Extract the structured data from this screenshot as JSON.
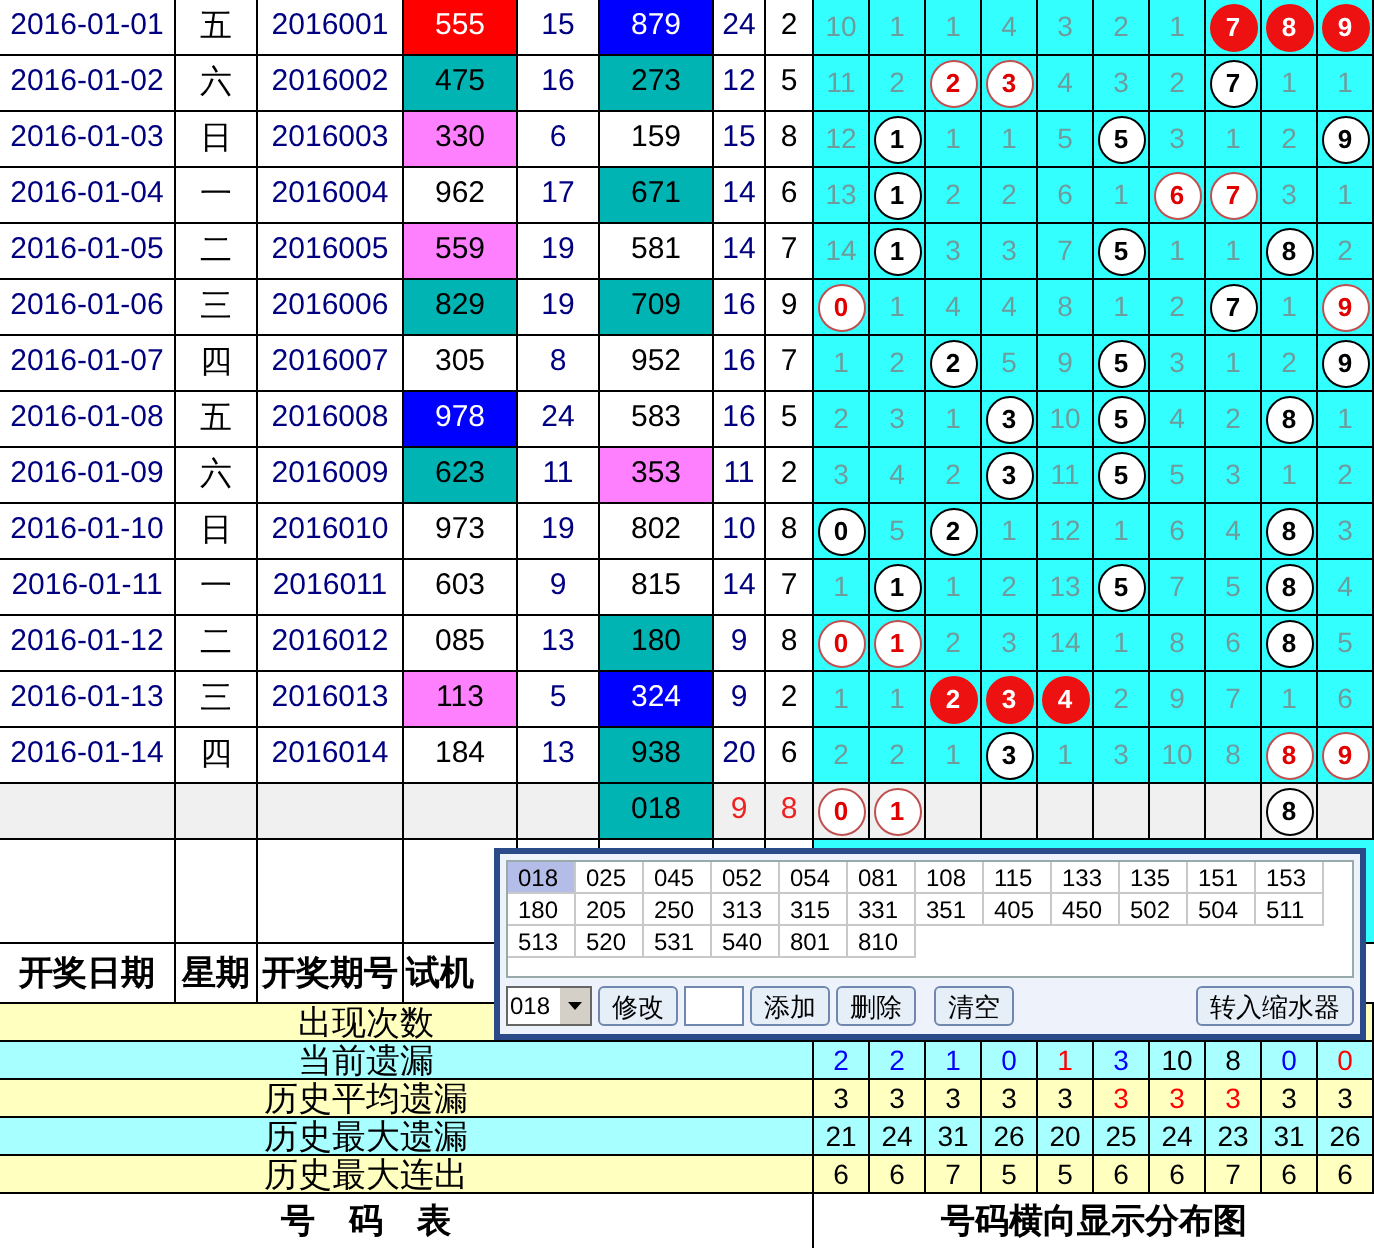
{
  "rows": [
    {
      "date": "2016-01-01",
      "week": "五",
      "issue": "2016001",
      "test": {
        "value": "555",
        "color": "#ff0000"
      },
      "test_sum": "15",
      "open": {
        "value": "879",
        "color": "#0000ff"
      },
      "open_sum": "24",
      "span": "2",
      "cells": [
        {
          "value": "10",
          "kind": "miss"
        },
        {
          "value": "1",
          "kind": "miss"
        },
        {
          "value": "1",
          "kind": "miss"
        },
        {
          "value": "4",
          "kind": "miss"
        },
        {
          "value": "3",
          "kind": "miss"
        },
        {
          "value": "2",
          "kind": "miss"
        },
        {
          "value": "1",
          "kind": "miss"
        },
        {
          "value": "7",
          "kind": "hot"
        },
        {
          "value": "8",
          "kind": "hot"
        },
        {
          "value": "9",
          "kind": "hot"
        }
      ]
    },
    {
      "date": "2016-01-02",
      "week": "六",
      "issue": "2016002",
      "test": {
        "value": "475",
        "color": "#00b4b4"
      },
      "test_sum": "16",
      "open": {
        "value": "273",
        "color": "#00b4b4"
      },
      "open_sum": "12",
      "span": "5",
      "cells": [
        {
          "value": "11",
          "kind": "miss"
        },
        {
          "value": "2",
          "kind": "miss"
        },
        {
          "value": "2",
          "kind": "red"
        },
        {
          "value": "3",
          "kind": "red"
        },
        {
          "value": "4",
          "kind": "miss"
        },
        {
          "value": "3",
          "kind": "miss"
        },
        {
          "value": "2",
          "kind": "miss"
        },
        {
          "value": "7",
          "kind": "hit"
        },
        {
          "value": "1",
          "kind": "miss"
        },
        {
          "value": "1",
          "kind": "miss"
        }
      ]
    },
    {
      "date": "2016-01-03",
      "week": "日",
      "issue": "2016003",
      "test": {
        "value": "330",
        "color": "#ff80ff"
      },
      "test_sum": "6",
      "open": {
        "value": "159"
      },
      "open_sum": "15",
      "span": "8",
      "cells": [
        {
          "value": "12",
          "kind": "miss"
        },
        {
          "value": "1",
          "kind": "hit"
        },
        {
          "value": "1",
          "kind": "miss"
        },
        {
          "value": "1",
          "kind": "miss"
        },
        {
          "value": "5",
          "kind": "miss"
        },
        {
          "value": "5",
          "kind": "hit"
        },
        {
          "value": "3",
          "kind": "miss"
        },
        {
          "value": "1",
          "kind": "miss"
        },
        {
          "value": "2",
          "kind": "miss"
        },
        {
          "value": "9",
          "kind": "hit"
        }
      ]
    },
    {
      "date": "2016-01-04",
      "week": "一",
      "issue": "2016004",
      "test": {
        "value": "962"
      },
      "test_sum": "17",
      "open": {
        "value": "671",
        "color": "#00b4b4"
      },
      "open_sum": "14",
      "span": "6",
      "cells": [
        {
          "value": "13",
          "kind": "miss"
        },
        {
          "value": "1",
          "kind": "hit"
        },
        {
          "value": "2",
          "kind": "miss"
        },
        {
          "value": "2",
          "kind": "miss"
        },
        {
          "value": "6",
          "kind": "miss"
        },
        {
          "value": "1",
          "kind": "miss"
        },
        {
          "value": "6",
          "kind": "red"
        },
        {
          "value": "7",
          "kind": "red"
        },
        {
          "value": "3",
          "kind": "miss"
        },
        {
          "value": "1",
          "kind": "miss"
        }
      ]
    },
    {
      "date": "2016-01-05",
      "week": "二",
      "issue": "2016005",
      "test": {
        "value": "559",
        "color": "#ff80ff"
      },
      "test_sum": "19",
      "open": {
        "value": "581"
      },
      "open_sum": "14",
      "span": "7",
      "cells": [
        {
          "value": "14",
          "kind": "miss"
        },
        {
          "value": "1",
          "kind": "hit"
        },
        {
          "value": "3",
          "kind": "miss"
        },
        {
          "value": "3",
          "kind": "miss"
        },
        {
          "value": "7",
          "kind": "miss"
        },
        {
          "value": "5",
          "kind": "hit"
        },
        {
          "value": "1",
          "kind": "miss"
        },
        {
          "value": "1",
          "kind": "miss"
        },
        {
          "value": "8",
          "kind": "hit"
        },
        {
          "value": "2",
          "kind": "miss"
        }
      ]
    },
    {
      "date": "2016-01-06",
      "week": "三",
      "issue": "2016006",
      "test": {
        "value": "829",
        "color": "#00b4b4"
      },
      "test_sum": "19",
      "open": {
        "value": "709",
        "color": "#00b4b4"
      },
      "open_sum": "16",
      "span": "9",
      "cells": [
        {
          "value": "0",
          "kind": "red"
        },
        {
          "value": "1",
          "kind": "miss"
        },
        {
          "value": "4",
          "kind": "miss"
        },
        {
          "value": "4",
          "kind": "miss"
        },
        {
          "value": "8",
          "kind": "miss"
        },
        {
          "value": "1",
          "kind": "miss"
        },
        {
          "value": "2",
          "kind": "miss"
        },
        {
          "value": "7",
          "kind": "hit"
        },
        {
          "value": "1",
          "kind": "miss"
        },
        {
          "value": "9",
          "kind": "red"
        }
      ]
    },
    {
      "date": "2016-01-07",
      "week": "四",
      "issue": "2016007",
      "test": {
        "value": "305"
      },
      "test_sum": "8",
      "open": {
        "value": "952"
      },
      "open_sum": "16",
      "span": "7",
      "cells": [
        {
          "value": "1",
          "kind": "miss"
        },
        {
          "value": "2",
          "kind": "miss"
        },
        {
          "value": "2",
          "kind": "hit"
        },
        {
          "value": "5",
          "kind": "miss"
        },
        {
          "value": "9",
          "kind": "miss"
        },
        {
          "value": "5",
          "kind": "hit"
        },
        {
          "value": "3",
          "kind": "miss"
        },
        {
          "value": "1",
          "kind": "miss"
        },
        {
          "value": "2",
          "kind": "miss"
        },
        {
          "value": "9",
          "kind": "hit"
        }
      ]
    },
    {
      "date": "2016-01-08",
      "week": "五",
      "issue": "2016008",
      "test": {
        "value": "978",
        "color": "#0000ff"
      },
      "test_sum": "24",
      "open": {
        "value": "583"
      },
      "open_sum": "16",
      "span": "5",
      "cells": [
        {
          "value": "2",
          "kind": "miss"
        },
        {
          "value": "3",
          "kind": "miss"
        },
        {
          "value": "1",
          "kind": "miss"
        },
        {
          "value": "3",
          "kind": "hit"
        },
        {
          "value": "10",
          "kind": "miss"
        },
        {
          "value": "5",
          "kind": "hit"
        },
        {
          "value": "4",
          "kind": "miss"
        },
        {
          "value": "2",
          "kind": "miss"
        },
        {
          "value": "8",
          "kind": "hit"
        },
        {
          "value": "1",
          "kind": "miss"
        }
      ]
    },
    {
      "date": "2016-01-09",
      "week": "六",
      "issue": "2016009",
      "test": {
        "value": "623",
        "color": "#00b4b4"
      },
      "test_sum": "11",
      "open": {
        "value": "353",
        "color": "#ff80ff"
      },
      "open_sum": "11",
      "span": "2",
      "cells": [
        {
          "value": "3",
          "kind": "miss"
        },
        {
          "value": "4",
          "kind": "miss"
        },
        {
          "value": "2",
          "kind": "miss"
        },
        {
          "value": "3",
          "kind": "hit"
        },
        {
          "value": "11",
          "kind": "miss"
        },
        {
          "value": "5",
          "kind": "hit"
        },
        {
          "value": "5",
          "kind": "miss"
        },
        {
          "value": "3",
          "kind": "miss"
        },
        {
          "value": "1",
          "kind": "miss"
        },
        {
          "value": "2",
          "kind": "miss"
        }
      ]
    },
    {
      "date": "2016-01-10",
      "week": "日",
      "issue": "2016010",
      "test": {
        "value": "973"
      },
      "test_sum": "19",
      "open": {
        "value": "802"
      },
      "open_sum": "10",
      "span": "8",
      "cells": [
        {
          "value": "0",
          "kind": "hit"
        },
        {
          "value": "5",
          "kind": "miss"
        },
        {
          "value": "2",
          "kind": "hit"
        },
        {
          "value": "1",
          "kind": "miss"
        },
        {
          "value": "12",
          "kind": "miss"
        },
        {
          "value": "1",
          "kind": "miss"
        },
        {
          "value": "6",
          "kind": "miss"
        },
        {
          "value": "4",
          "kind": "miss"
        },
        {
          "value": "8",
          "kind": "hit"
        },
        {
          "value": "3",
          "kind": "miss"
        }
      ]
    },
    {
      "date": "2016-01-11",
      "week": "一",
      "issue": "2016011",
      "test": {
        "value": "603"
      },
      "test_sum": "9",
      "open": {
        "value": "815"
      },
      "open_sum": "14",
      "span": "7",
      "cells": [
        {
          "value": "1",
          "kind": "miss"
        },
        {
          "value": "1",
          "kind": "hit"
        },
        {
          "value": "1",
          "kind": "miss"
        },
        {
          "value": "2",
          "kind": "miss"
        },
        {
          "value": "13",
          "kind": "miss"
        },
        {
          "value": "5",
          "kind": "hit"
        },
        {
          "value": "7",
          "kind": "miss"
        },
        {
          "value": "5",
          "kind": "miss"
        },
        {
          "value": "8",
          "kind": "hit"
        },
        {
          "value": "4",
          "kind": "miss"
        }
      ]
    },
    {
      "date": "2016-01-12",
      "week": "二",
      "issue": "2016012",
      "test": {
        "value": "085"
      },
      "test_sum": "13",
      "open": {
        "value": "180",
        "color": "#00b4b4"
      },
      "open_sum": "9",
      "span": "8",
      "cells": [
        {
          "value": "0",
          "kind": "red"
        },
        {
          "value": "1",
          "kind": "red"
        },
        {
          "value": "2",
          "kind": "miss"
        },
        {
          "value": "3",
          "kind": "miss"
        },
        {
          "value": "14",
          "kind": "miss"
        },
        {
          "value": "1",
          "kind": "miss"
        },
        {
          "value": "8",
          "kind": "miss"
        },
        {
          "value": "6",
          "kind": "miss"
        },
        {
          "value": "8",
          "kind": "hit"
        },
        {
          "value": "5",
          "kind": "miss"
        }
      ]
    },
    {
      "date": "2016-01-13",
      "week": "三",
      "issue": "2016013",
      "test": {
        "value": "113",
        "color": "#ff80ff"
      },
      "test_sum": "5",
      "open": {
        "value": "324",
        "color": "#0000ff"
      },
      "open_sum": "9",
      "span": "2",
      "cells": [
        {
          "value": "1",
          "kind": "miss"
        },
        {
          "value": "1",
          "kind": "miss"
        },
        {
          "value": "2",
          "kind": "hot"
        },
        {
          "value": "3",
          "kind": "hot"
        },
        {
          "value": "4",
          "kind": "hot"
        },
        {
          "value": "2",
          "kind": "miss"
        },
        {
          "value": "9",
          "kind": "miss"
        },
        {
          "value": "7",
          "kind": "miss"
        },
        {
          "value": "1",
          "kind": "miss"
        },
        {
          "value": "6",
          "kind": "miss"
        }
      ]
    },
    {
      "date": "2016-01-14",
      "week": "四",
      "issue": "2016014",
      "test": {
        "value": "184"
      },
      "test_sum": "13",
      "open": {
        "value": "938",
        "color": "#00b4b4"
      },
      "open_sum": "20",
      "span": "6",
      "cells": [
        {
          "value": "2",
          "kind": "miss"
        },
        {
          "value": "2",
          "kind": "miss"
        },
        {
          "value": "1",
          "kind": "miss"
        },
        {
          "value": "3",
          "kind": "hit"
        },
        {
          "value": "1",
          "kind": "miss"
        },
        {
          "value": "3",
          "kind": "miss"
        },
        {
          "value": "10",
          "kind": "miss"
        },
        {
          "value": "8",
          "kind": "miss"
        },
        {
          "value": "8",
          "kind": "red"
        },
        {
          "value": "9",
          "kind": "red"
        }
      ]
    }
  ],
  "forecast": {
    "open": {
      "value": "018",
      "color": "#00b4b4"
    },
    "open_sum": "9",
    "span": "8",
    "cells": [
      {
        "value": "0",
        "kind": "red"
      },
      {
        "value": "1",
        "kind": "red"
      },
      {
        "kind": "empty"
      },
      {
        "kind": "empty"
      },
      {
        "kind": "empty"
      },
      {
        "kind": "empty"
      },
      {
        "kind": "empty"
      },
      {
        "kind": "empty"
      },
      {
        "value": "8",
        "kind": "hit"
      },
      {
        "kind": "empty"
      }
    ]
  },
  "headers": [
    "开奖日期",
    "星期",
    "开奖期号",
    "试机"
  ],
  "stats": [
    {
      "label": "出现次数"
    },
    {
      "label": "当前遗漏",
      "values": [
        {
          "value": "2",
          "color": "#0000ff"
        },
        {
          "value": "2",
          "color": "#0000ff"
        },
        {
          "value": "1",
          "color": "#0000ff"
        },
        {
          "value": "0",
          "color": "#0000ff"
        },
        {
          "value": "1",
          "color": "#ff0000"
        },
        {
          "value": "3",
          "color": "#0000ff"
        },
        {
          "value": "10",
          "color": "#000000"
        },
        {
          "value": "8",
          "color": "#000000"
        },
        {
          "value": "0",
          "color": "#0000ff"
        },
        {
          "value": "0",
          "color": "#ff0000"
        }
      ]
    },
    {
      "label": "历史平均遗漏",
      "values": [
        {
          "value": "3",
          "color": "#000000"
        },
        {
          "value": "3",
          "color": "#000000"
        },
        {
          "value": "3",
          "color": "#000000"
        },
        {
          "value": "3",
          "color": "#000000"
        },
        {
          "value": "3",
          "color": "#000000"
        },
        {
          "value": "3",
          "color": "#ff0000"
        },
        {
          "value": "3",
          "color": "#ff0000"
        },
        {
          "value": "3",
          "color": "#ff0000"
        },
        {
          "value": "3",
          "color": "#000000"
        },
        {
          "value": "3",
          "color": "#000000"
        }
      ]
    },
    {
      "label": "历史最大遗漏",
      "values": [
        {
          "value": "21",
          "color": "#000000"
        },
        {
          "value": "24",
          "color": "#000000"
        },
        {
          "value": "31",
          "color": "#000000"
        },
        {
          "value": "26",
          "color": "#000000"
        },
        {
          "value": "20",
          "color": "#000000"
        },
        {
          "value": "25",
          "color": "#000000"
        },
        {
          "value": "24",
          "color": "#000000"
        },
        {
          "value": "23",
          "color": "#000000"
        },
        {
          "value": "31",
          "color": "#000000"
        },
        {
          "value": "26",
          "color": "#000000"
        }
      ]
    },
    {
      "label": "历史最大连出",
      "values": [
        {
          "value": "6",
          "color": "#000000"
        },
        {
          "value": "6",
          "color": "#000000"
        },
        {
          "value": "7",
          "color": "#000000"
        },
        {
          "value": "5",
          "color": "#000000"
        },
        {
          "value": "5",
          "color": "#000000"
        },
        {
          "value": "6",
          "color": "#000000"
        },
        {
          "value": "6",
          "color": "#000000"
        },
        {
          "value": "7",
          "color": "#000000"
        },
        {
          "value": "6",
          "color": "#000000"
        },
        {
          "value": "6",
          "color": "#000000"
        }
      ]
    }
  ],
  "footer": {
    "left": "号　码　表",
    "right": "号码横向显示分布图"
  },
  "picker": {
    "items": [
      {
        "value": "018",
        "selected": true
      },
      {
        "value": "025",
        "selected": false
      },
      {
        "value": "045",
        "selected": false
      },
      {
        "value": "052",
        "selected": false
      },
      {
        "value": "054",
        "selected": false
      },
      {
        "value": "081",
        "selected": false
      },
      {
        "value": "108",
        "selected": false
      },
      {
        "value": "115",
        "selected": false
      },
      {
        "value": "133",
        "selected": false
      },
      {
        "value": "135",
        "selected": false
      },
      {
        "value": "151",
        "selected": false
      },
      {
        "value": "153",
        "selected": false
      },
      {
        "value": "180",
        "selected": false
      },
      {
        "value": "205",
        "selected": false
      },
      {
        "value": "250",
        "selected": false
      },
      {
        "value": "313",
        "selected": false
      },
      {
        "value": "315",
        "selected": false
      },
      {
        "value": "331",
        "selected": false
      },
      {
        "value": "351",
        "selected": false
      },
      {
        "value": "405",
        "selected": false
      },
      {
        "value": "450",
        "selected": false
      },
      {
        "value": "502",
        "selected": false
      },
      {
        "value": "504",
        "selected": false
      },
      {
        "value": "511",
        "selected": false
      },
      {
        "value": "513",
        "selected": false
      },
      {
        "value": "520",
        "selected": false
      },
      {
        "value": "531",
        "selected": false
      },
      {
        "value": "540",
        "selected": false
      },
      {
        "value": "801",
        "selected": false
      },
      {
        "value": "810",
        "selected": false
      }
    ],
    "select_value": "018",
    "edit_button": "修改",
    "buttons": [
      "添加",
      "删除",
      "清空"
    ],
    "transfer_button": "转入缩水器"
  }
}
